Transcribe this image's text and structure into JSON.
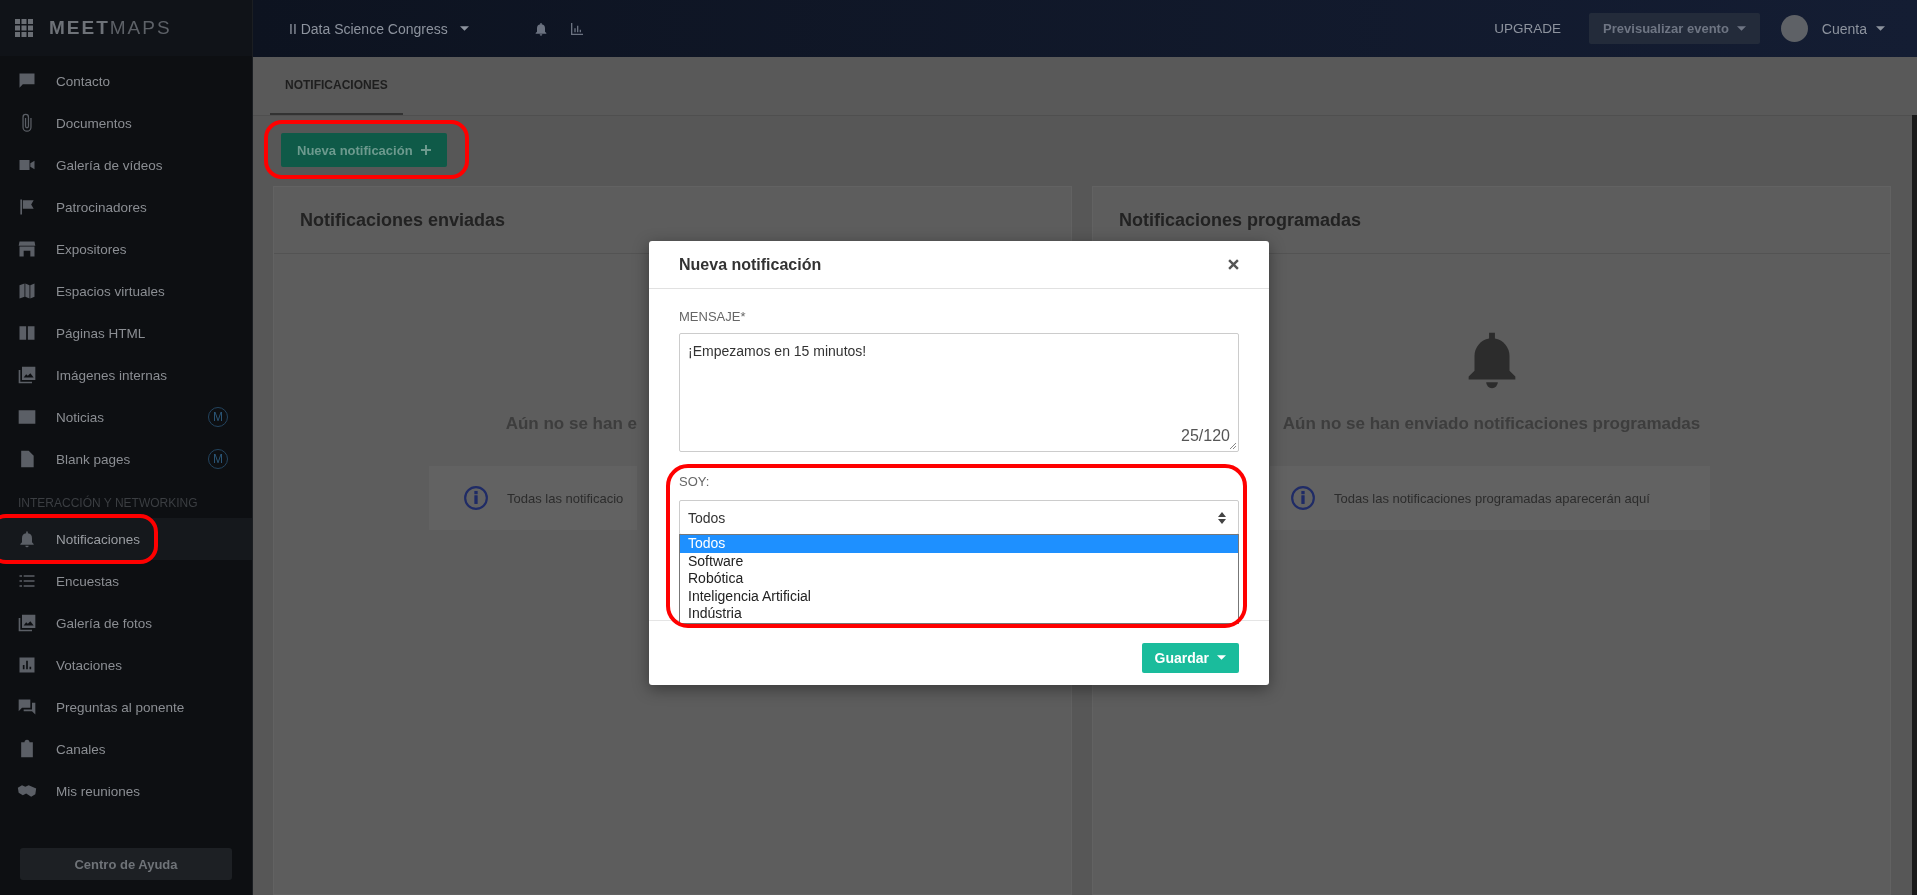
{
  "brand": {
    "bold": "MEET",
    "light": "MAPS"
  },
  "topbar": {
    "event": "II Data Science Congress",
    "upgrade": "UPGRADE",
    "preview": "Previsualizar evento",
    "account": "Cuenta"
  },
  "sidebar": {
    "groups": [
      {
        "items": [
          {
            "label": "Contacto",
            "selected": false,
            "highlighted": false
          },
          {
            "label": "Documentos",
            "selected": false,
            "highlighted": false
          },
          {
            "label": "Galería de vídeos",
            "selected": false,
            "highlighted": false
          },
          {
            "label": "Patrocinadores",
            "selected": false,
            "highlighted": false
          },
          {
            "label": "Expositores",
            "selected": false,
            "highlighted": false
          },
          {
            "label": "Espacios virtuales",
            "selected": false,
            "highlighted": false
          },
          {
            "label": "Páginas HTML",
            "selected": false,
            "highlighted": false
          },
          {
            "label": "Imágenes internas",
            "selected": false,
            "highlighted": false
          },
          {
            "label": "Noticias",
            "badge": "M",
            "selected": false,
            "highlighted": false
          },
          {
            "label": "Blank pages",
            "badge": "M",
            "selected": false,
            "highlighted": false
          }
        ]
      },
      {
        "title": "INTERACCIÓN Y NETWORKING",
        "items": [
          {
            "label": "Notificaciones",
            "selected": true,
            "highlighted": true
          },
          {
            "label": "Encuestas",
            "selected": false,
            "highlighted": false
          },
          {
            "label": "Galería de fotos",
            "selected": false,
            "highlighted": false
          },
          {
            "label": "Votaciones",
            "selected": false,
            "highlighted": false
          },
          {
            "label": "Preguntas al ponente",
            "selected": false,
            "highlighted": false
          },
          {
            "label": "Canales",
            "selected": false,
            "highlighted": false
          },
          {
            "label": "Mis reuniones",
            "selected": false,
            "highlighted": false
          }
        ]
      }
    ],
    "help": "Centro de Ayuda"
  },
  "tabs": [
    {
      "label": "NOTIFICACIONES",
      "selected": true
    }
  ],
  "new_button": {
    "label": "Nueva notificación",
    "highlighted": true
  },
  "panels": [
    {
      "title": "Notificaciones enviadas",
      "empty_text": "Aún no se han e",
      "info_text": "Todas las notificacio",
      "covered": true
    },
    {
      "title": "Notificaciones programadas",
      "empty_text": "Aún no se han enviado notificaciones programadas",
      "info_text": "Todas las notificaciones programadas aparecerán aquí",
      "covered": false
    }
  ],
  "modal": {
    "title": "Nueva notificación",
    "message_label": "MENSAJE*",
    "message": "¡Empezamos en 15 minutos!",
    "counter": "25/120",
    "audience_label": "SOY:",
    "audience_value": "Todos",
    "audience_highlighted": true,
    "options": [
      {
        "label": "Todos",
        "selected": true
      },
      {
        "label": "Software",
        "selected": false
      },
      {
        "label": "Robótica",
        "selected": false
      },
      {
        "label": "Inteligencia Artificial",
        "selected": false
      },
      {
        "label": "Indústria",
        "selected": false
      }
    ],
    "save": "Guardar"
  }
}
